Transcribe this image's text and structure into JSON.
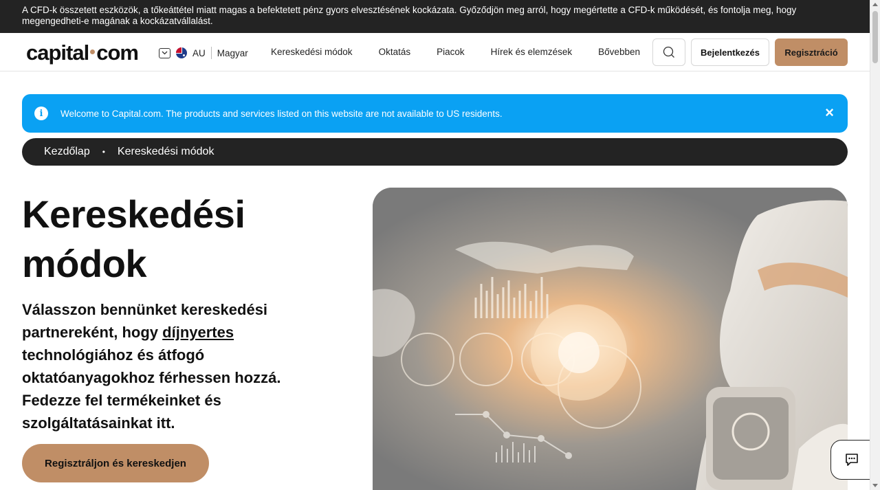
{
  "risk_warning": "A CFD-k összetett eszközök, a tőkeáttétel miatt magas a befektetett pénz gyors elvesztésének kockázata. Győződjön meg arról, hogy megértette a CFD-k működését, és fontolja meg, hogy megengedheti-e magának a kockázatvállalást.",
  "header": {
    "logo_left": "capital",
    "logo_right": "com",
    "region": "AU",
    "language": "Magyar",
    "nav": [
      "Kereskedési módok",
      "Oktatás",
      "Piacok",
      "Hírek és elemzések",
      "Bővebben"
    ],
    "login": "Bejelentkezés",
    "register": "Regisztráció"
  },
  "notice": {
    "text": "Welcome to Capital.com. The products and services listed on this website are not available to US residents.",
    "close": "×",
    "info": "i"
  },
  "breadcrumb": {
    "home": "Kezdőlap",
    "separator": "•",
    "current": "Kereskedési módok"
  },
  "hero": {
    "title_line1": "Kereskedési",
    "title_line2": "módok",
    "text_before": "Válasszon bennünket kereskedési partnereként, hogy ",
    "text_link": "díjnyertes",
    "text_after": " technológiához és átfogó oktatóanyagokhoz férhessen hozzá. Fedezze fel termékeinket és szolgáltatásainkat itt.",
    "cta": "Regisztráljon és kereskedjen"
  },
  "colors": {
    "accent": "#c08e66",
    "notice_blue": "#0aa1f3",
    "dark": "#232323"
  },
  "icons": {
    "search": "search-icon",
    "chat": "chat-icon",
    "info": "info-icon",
    "close": "close-icon",
    "chevron": "chevron-down-icon",
    "flag": "australia-flag-icon"
  }
}
